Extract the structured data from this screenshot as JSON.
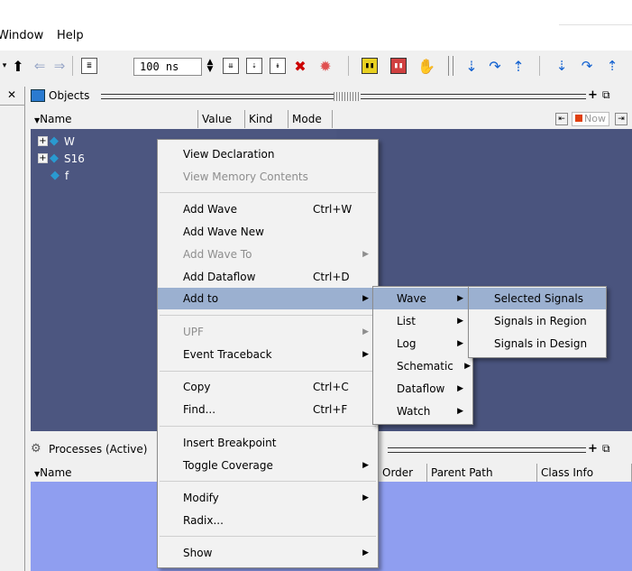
{
  "menubar": {
    "items": [
      "Window",
      "Help"
    ]
  },
  "toolbar": {
    "time_value": "100 ns",
    "icons": [
      "dropdown-arrow-icon",
      "up-arrow-icon",
      "back-icon",
      "forward-icon",
      "run-length-icon",
      "spin-arrows-icon",
      "restart-icon",
      "run-icon",
      "run-continue-icon",
      "break-icon",
      "stop-icon",
      "wave-icon",
      "memory-icon",
      "hand-icon",
      "step-into-icon",
      "step-over-icon",
      "step-out-icon",
      "c-step-into-icon",
      "c-step-over-icon",
      "c-step-out-icon"
    ]
  },
  "objects": {
    "title": "Objects",
    "columns": [
      "Name",
      "Value",
      "Kind",
      "Mode"
    ],
    "rows": [
      {
        "name": "W",
        "expandable": true
      },
      {
        "name": "S16",
        "expandable": true
      },
      {
        "name": "f",
        "expandable": false
      }
    ],
    "header_right": "Now"
  },
  "processes": {
    "title": "Processes (Active)",
    "columns": [
      "Name",
      "Order",
      "Parent Path",
      "Class Info"
    ]
  },
  "context_menu": {
    "items": [
      {
        "label": "View Declaration",
        "enabled": true
      },
      {
        "label": "View Memory Contents",
        "enabled": false
      },
      {
        "label": "Add Wave",
        "shortcut": "Ctrl+W",
        "enabled": true
      },
      {
        "label": "Add Wave New",
        "enabled": true
      },
      {
        "label": "Add Wave To",
        "enabled": false,
        "submenu": true
      },
      {
        "label": "Add Dataflow",
        "shortcut": "Ctrl+D",
        "enabled": true
      },
      {
        "label": "Add to",
        "enabled": true,
        "submenu": true,
        "highlighted": true
      },
      {
        "label": "UPF",
        "enabled": false,
        "submenu": true
      },
      {
        "label": "Event Traceback",
        "enabled": true,
        "submenu": true
      },
      {
        "label": "Copy",
        "shortcut": "Ctrl+C",
        "enabled": true
      },
      {
        "label": "Find...",
        "shortcut": "Ctrl+F",
        "enabled": true
      },
      {
        "label": "Insert Breakpoint",
        "enabled": true
      },
      {
        "label": "Toggle Coverage",
        "enabled": true,
        "submenu": true
      },
      {
        "label": "Modify",
        "enabled": true,
        "submenu": true
      },
      {
        "label": "Radix...",
        "enabled": true
      },
      {
        "label": "Show",
        "enabled": true,
        "submenu": true
      }
    ]
  },
  "addto_submenu": {
    "items": [
      {
        "label": "Wave",
        "highlighted": true
      },
      {
        "label": "List"
      },
      {
        "label": "Log"
      },
      {
        "label": "Schematic"
      },
      {
        "label": "Dataflow"
      },
      {
        "label": "Watch"
      }
    ]
  },
  "wave_submenu": {
    "items": [
      {
        "label": "Selected Signals",
        "highlighted": true
      },
      {
        "label": "Signals in Region"
      },
      {
        "label": "Signals in Design"
      }
    ]
  }
}
